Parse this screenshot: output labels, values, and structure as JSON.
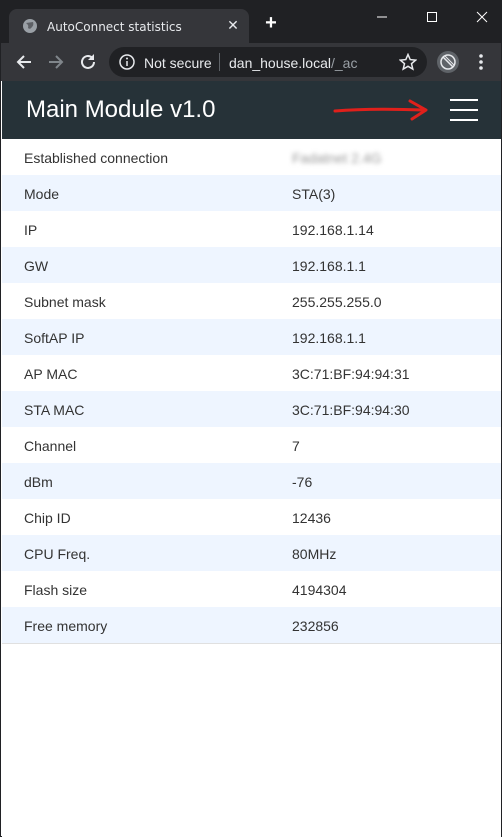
{
  "browser": {
    "tab_title": "AutoConnect statistics",
    "security_label": "Not secure",
    "url_host": "dan_house.local",
    "url_path": "/_ac"
  },
  "page": {
    "title": "Main Module v1.0",
    "annotation_color": "#e0201b",
    "stats": [
      {
        "label": "Established connection",
        "value": "Fadatnet 2.4G"
      },
      {
        "label": "Mode",
        "value": "STA(3)"
      },
      {
        "label": "IP",
        "value": "192.168.1.14"
      },
      {
        "label": "GW",
        "value": "192.168.1.1"
      },
      {
        "label": "Subnet mask",
        "value": "255.255.255.0"
      },
      {
        "label": "SoftAP IP",
        "value": "192.168.1.1"
      },
      {
        "label": "AP MAC",
        "value": "3C:71:BF:94:94:31"
      },
      {
        "label": "STA MAC",
        "value": "3C:71:BF:94:94:30"
      },
      {
        "label": "Channel",
        "value": "7"
      },
      {
        "label": "dBm",
        "value": "-76"
      },
      {
        "label": "Chip ID",
        "value": "12436"
      },
      {
        "label": "CPU Freq.",
        "value": "80MHz"
      },
      {
        "label": "Flash size",
        "value": "4194304"
      },
      {
        "label": "Free memory",
        "value": "232856"
      }
    ]
  },
  "colors": {
    "header_bg": "#263238",
    "row_alt_bg": "#eef5ff"
  }
}
